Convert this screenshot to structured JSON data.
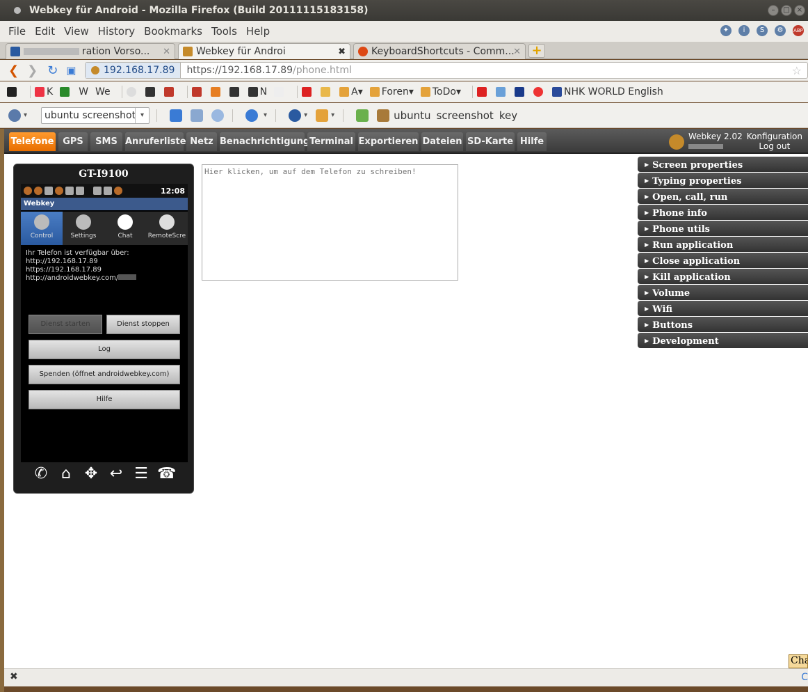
{
  "window": {
    "title": "Webkey für Android - Mozilla Firefox (Build 20111115183158)"
  },
  "menu": [
    "File",
    "Edit",
    "View",
    "History",
    "Bookmarks",
    "Tools",
    "Help"
  ],
  "tabs": [
    {
      "label": "ration Vorso...",
      "active": false
    },
    {
      "label": "Webkey für Androi",
      "active": true
    },
    {
      "label": "KeyboardShortcuts - Comm...",
      "active": false
    }
  ],
  "url": {
    "identity": "192.168.17.89",
    "host": "https://192.168.17.89",
    "path": "/phone.html"
  },
  "bookmarks": [
    "K",
    "W",
    "We",
    "N",
    "A",
    "Foren",
    "ToDo",
    "NHK WORLD English"
  ],
  "toolbar2": {
    "search_value": "ubuntu screenshot",
    "links": [
      "ubuntu",
      "screenshot",
      "key"
    ]
  },
  "webkey": {
    "nav": [
      "Telefone",
      "GPS",
      "SMS",
      "Anruferliste",
      "Netz",
      "Benachrichtigung",
      "Terminal",
      "Exportieren",
      "Dateien",
      "SD-Karte",
      "Hilfe"
    ],
    "version": "Webkey 2.02",
    "config_label": "Konfiguration",
    "logout_label": "Log out"
  },
  "phone": {
    "model": "GT-I9100",
    "clock": "12:08",
    "app_title": "Webkey",
    "app_tabs": [
      "Control",
      "Settings",
      "Chat",
      "RemoteScre"
    ],
    "info_lines": [
      "Ihr Telefon ist verfügbar über:",
      "http://192.168.17.89",
      "https://192.168.17.89",
      "http://androidwebkey.com/"
    ],
    "buttons": {
      "start": "Dienst starten",
      "stop": "Dienst stoppen",
      "log": "Log",
      "donate": "Spenden (öffnet androidwebkey.com)",
      "help": "Hilfe"
    }
  },
  "typing_area": {
    "placeholder": "Hier klicken, um auf dem Telefon zu schreiben!"
  },
  "panels": [
    "Screen properties",
    "Typing properties",
    "Open, call, run",
    "Phone info",
    "Phone utils",
    "Run application",
    "Close application",
    "Kill application",
    "Volume",
    "Wifi",
    "Buttons",
    "Development"
  ],
  "chat_tag": "Cha",
  "colors": {
    "active_nav": "#e86e00",
    "phone_accent": "#2a5aa0"
  }
}
